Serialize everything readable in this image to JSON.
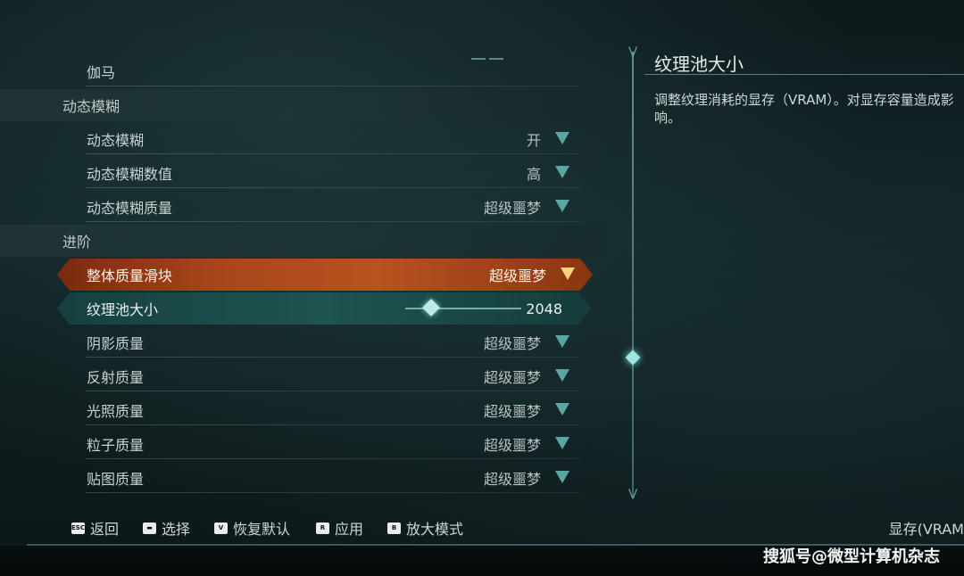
{
  "list": {
    "rows": [
      {
        "kind": "setting",
        "label": "伽马",
        "value": ""
      },
      {
        "kind": "section",
        "label": "动态模糊"
      },
      {
        "kind": "setting",
        "label": "动态模糊",
        "value": "开"
      },
      {
        "kind": "setting",
        "label": "动态模糊数值",
        "value": "高"
      },
      {
        "kind": "setting",
        "label": "动态模糊质量",
        "value": "超级噩梦"
      },
      {
        "kind": "section",
        "label": "进阶"
      },
      {
        "kind": "active",
        "label": "整体质量滑块",
        "value": "超级噩梦"
      },
      {
        "kind": "slider",
        "label": "纹理池大小",
        "value": "2048",
        "level_fraction": 0.22
      },
      {
        "kind": "setting",
        "label": "阴影质量",
        "value": "超级噩梦"
      },
      {
        "kind": "setting",
        "label": "反射质量",
        "value": "超级噩梦"
      },
      {
        "kind": "setting",
        "label": "光照质量",
        "value": "超级噩梦"
      },
      {
        "kind": "setting",
        "label": "粒子质量",
        "value": "超级噩梦"
      },
      {
        "kind": "setting",
        "label": "贴图质量",
        "value": "超级噩梦"
      }
    ]
  },
  "panel": {
    "title": "纹理池大小",
    "description": "调整纹理消耗的显存（VRAM）。对显存容量造成影响。"
  },
  "footer": {
    "hints": [
      {
        "key": "ESC",
        "label": "返回"
      },
      {
        "key": "▬",
        "label": "选择"
      },
      {
        "key": "V",
        "label": "恢复默认"
      },
      {
        "key": "R",
        "label": "应用"
      },
      {
        "key": "B",
        "label": "放大模式"
      }
    ],
    "right_text": "显存(VRAM"
  },
  "watermark": "搜狐号@微型计算机杂志",
  "colors": {
    "accent_orange": "#b8521f",
    "accent_teal": "#5aa6a2"
  }
}
